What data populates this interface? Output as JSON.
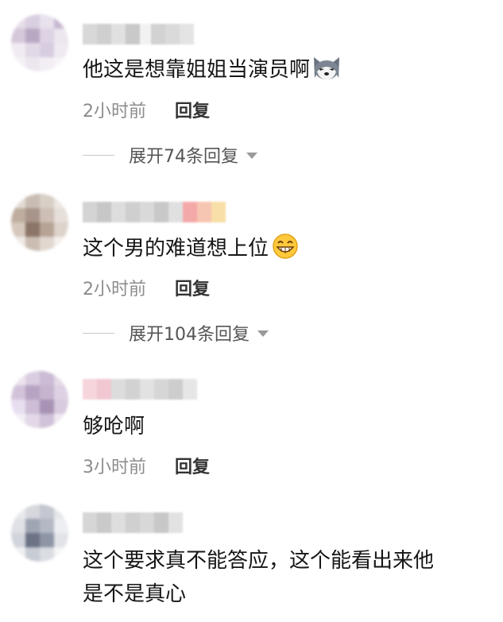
{
  "comments": [
    {
      "text": "他这是想靠姐姐当演员啊",
      "emoji": "husky-emoji",
      "time": "2小时前",
      "reply_label": "回复",
      "expand_label": "展开74条回复"
    },
    {
      "text": "这个男的难道想上位",
      "emoji": "grin-emoji",
      "time": "2小时前",
      "reply_label": "回复",
      "expand_label": "展开104条回复"
    },
    {
      "text": "够呛啊",
      "time": "3小时前",
      "reply_label": "回复"
    },
    {
      "text": "这个要求真不能答应，这个能看出来他\n是不是真心"
    }
  ],
  "colors": {
    "text": "#161616",
    "time": "#8c8c8c",
    "reply": "#333333",
    "expand": "#555555"
  }
}
